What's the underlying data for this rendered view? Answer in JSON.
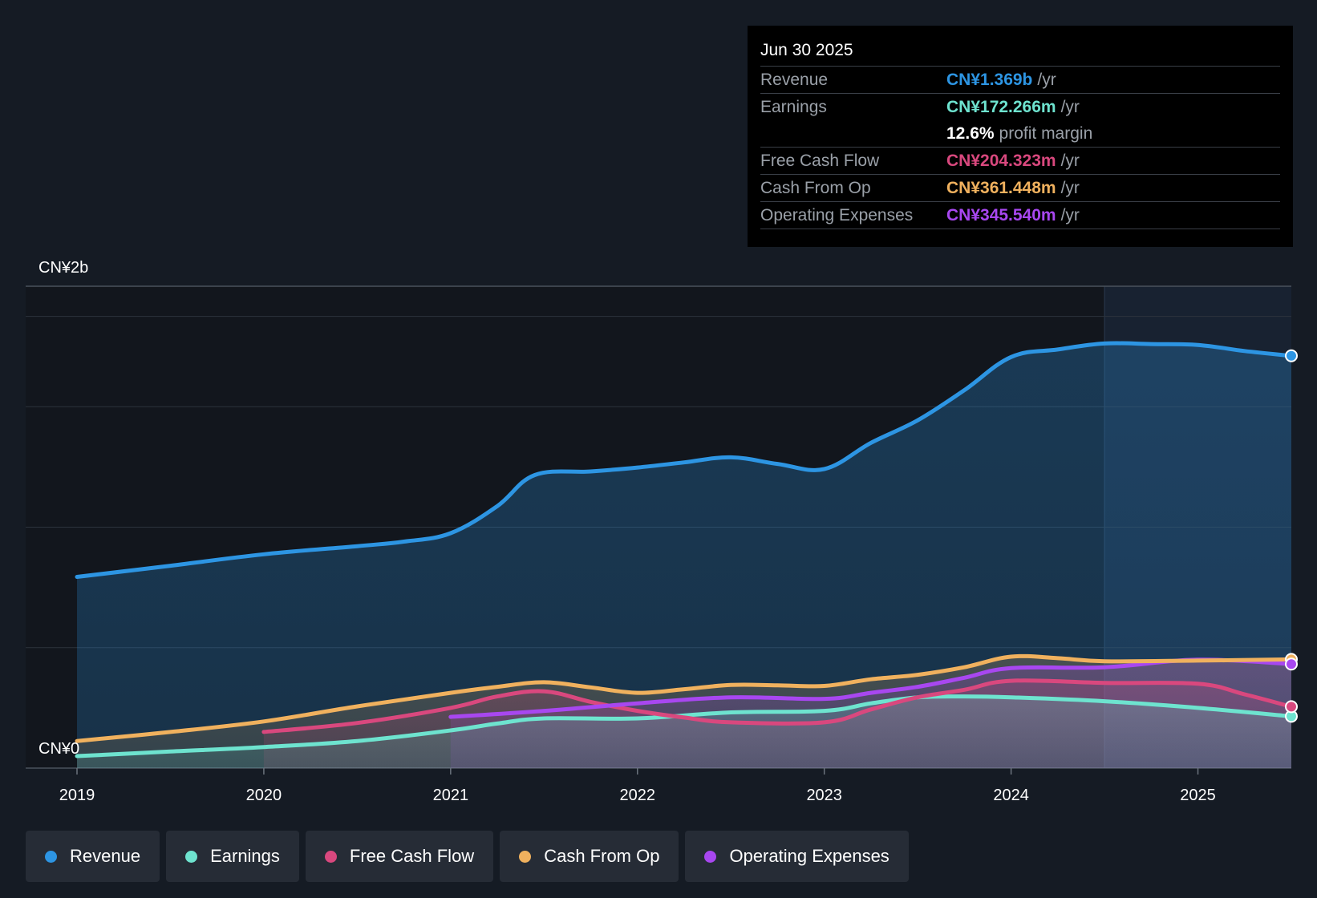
{
  "tooltip": {
    "date": "Jun 30 2025",
    "rows": [
      {
        "name": "Revenue",
        "value": "CN¥1.369b",
        "unit": "/yr",
        "color": "#2d95e3"
      },
      {
        "name": "Earnings",
        "value": "CN¥172.266m",
        "unit": "/yr",
        "color": "#6ee3cf"
      },
      {
        "name": "",
        "value": "12.6%",
        "unit": "profit margin",
        "color": "#ffffff"
      },
      {
        "name": "Free Cash Flow",
        "value": "CN¥204.323m",
        "unit": "/yr",
        "color": "#d9487e"
      },
      {
        "name": "Cash From Op",
        "value": "CN¥361.448m",
        "unit": "/yr",
        "color": "#f0b15e"
      },
      {
        "name": "Operating Expenses",
        "value": "CN¥345.540m",
        "unit": "/yr",
        "color": "#a847f0"
      }
    ]
  },
  "legend": [
    {
      "label": "Revenue",
      "color": "#2d95e3"
    },
    {
      "label": "Earnings",
      "color": "#6ee3cf"
    },
    {
      "label": "Free Cash Flow",
      "color": "#d9487e"
    },
    {
      "label": "Cash From Op",
      "color": "#f0b15e"
    },
    {
      "label": "Operating Expenses",
      "color": "#a847f0"
    }
  ],
  "chart_data": {
    "type": "area",
    "title": "",
    "xlabel": "",
    "ylabel": "",
    "y_tick_labels": [
      "CN¥2b",
      "CN¥0"
    ],
    "ylim": [
      0,
      1.6
    ],
    "y_unit": "CN¥b",
    "xlim": [
      2019.0,
      2025.5
    ],
    "x_ticks": [
      2019,
      2020,
      2021,
      2022,
      2023,
      2024,
      2025
    ],
    "x_tick_labels": [
      "2019",
      "2020",
      "2021",
      "2022",
      "2023",
      "2024",
      "2025"
    ],
    "grid": true,
    "legend_position": "bottom",
    "series": [
      {
        "name": "Revenue",
        "color": "#2d95e3",
        "points": [
          [
            2019.0,
            0.635
          ],
          [
            2019.5,
            0.672
          ],
          [
            2020.0,
            0.71
          ],
          [
            2020.5,
            0.737
          ],
          [
            2020.75,
            0.752
          ],
          [
            2021.0,
            0.78
          ],
          [
            2021.25,
            0.87
          ],
          [
            2021.45,
            0.973
          ],
          [
            2021.75,
            0.985
          ],
          [
            2022.0,
            0.998
          ],
          [
            2022.25,
            1.015
          ],
          [
            2022.5,
            1.032
          ],
          [
            2022.75,
            1.01
          ],
          [
            2023.0,
            0.993
          ],
          [
            2023.25,
            1.08
          ],
          [
            2023.5,
            1.155
          ],
          [
            2023.75,
            1.255
          ],
          [
            2024.0,
            1.365
          ],
          [
            2024.25,
            1.39
          ],
          [
            2024.5,
            1.41
          ],
          [
            2024.75,
            1.408
          ],
          [
            2025.0,
            1.405
          ],
          [
            2025.25,
            1.385
          ],
          [
            2025.5,
            1.369
          ]
        ]
      },
      {
        "name": "Earnings",
        "color": "#6ee3cf",
        "points": [
          [
            2019.0,
            0.04
          ],
          [
            2019.5,
            0.055
          ],
          [
            2020.0,
            0.07
          ],
          [
            2020.5,
            0.09
          ],
          [
            2021.0,
            0.125
          ],
          [
            2021.25,
            0.148
          ],
          [
            2021.5,
            0.165
          ],
          [
            2022.0,
            0.165
          ],
          [
            2022.5,
            0.185
          ],
          [
            2023.0,
            0.19
          ],
          [
            2023.25,
            0.215
          ],
          [
            2023.5,
            0.235
          ],
          [
            2023.75,
            0.238
          ],
          [
            2024.0,
            0.235
          ],
          [
            2024.5,
            0.222
          ],
          [
            2025.0,
            0.2
          ],
          [
            2025.5,
            0.172
          ]
        ]
      },
      {
        "name": "Free Cash Flow",
        "color": "#d9487e",
        "points": [
          [
            2020.0,
            0.12
          ],
          [
            2020.5,
            0.15
          ],
          [
            2021.0,
            0.2
          ],
          [
            2021.25,
            0.238
          ],
          [
            2021.5,
            0.255
          ],
          [
            2021.75,
            0.22
          ],
          [
            2022.0,
            0.19
          ],
          [
            2022.25,
            0.168
          ],
          [
            2022.5,
            0.152
          ],
          [
            2023.0,
            0.152
          ],
          [
            2023.25,
            0.195
          ],
          [
            2023.5,
            0.235
          ],
          [
            2023.75,
            0.26
          ],
          [
            2024.0,
            0.29
          ],
          [
            2024.5,
            0.283
          ],
          [
            2025.0,
            0.28
          ],
          [
            2025.25,
            0.245
          ],
          [
            2025.5,
            0.204
          ]
        ]
      },
      {
        "name": "Cash From Op",
        "color": "#f0b15e",
        "points": [
          [
            2019.0,
            0.09
          ],
          [
            2019.5,
            0.12
          ],
          [
            2020.0,
            0.155
          ],
          [
            2020.5,
            0.205
          ],
          [
            2021.0,
            0.25
          ],
          [
            2021.25,
            0.27
          ],
          [
            2021.5,
            0.285
          ],
          [
            2021.75,
            0.268
          ],
          [
            2022.0,
            0.25
          ],
          [
            2022.25,
            0.262
          ],
          [
            2022.5,
            0.276
          ],
          [
            2022.75,
            0.275
          ],
          [
            2023.0,
            0.273
          ],
          [
            2023.25,
            0.295
          ],
          [
            2023.5,
            0.31
          ],
          [
            2023.75,
            0.335
          ],
          [
            2024.0,
            0.37
          ],
          [
            2024.25,
            0.365
          ],
          [
            2024.5,
            0.355
          ],
          [
            2025.0,
            0.357
          ],
          [
            2025.5,
            0.361
          ]
        ]
      },
      {
        "name": "Operating Expenses",
        "color": "#a847f0",
        "points": [
          [
            2021.0,
            0.17
          ],
          [
            2021.5,
            0.19
          ],
          [
            2022.0,
            0.215
          ],
          [
            2022.5,
            0.235
          ],
          [
            2023.0,
            0.23
          ],
          [
            2023.25,
            0.25
          ],
          [
            2023.5,
            0.27
          ],
          [
            2023.75,
            0.3
          ],
          [
            2024.0,
            0.332
          ],
          [
            2024.5,
            0.335
          ],
          [
            2025.0,
            0.36
          ],
          [
            2025.5,
            0.3455
          ]
        ]
      }
    ]
  }
}
